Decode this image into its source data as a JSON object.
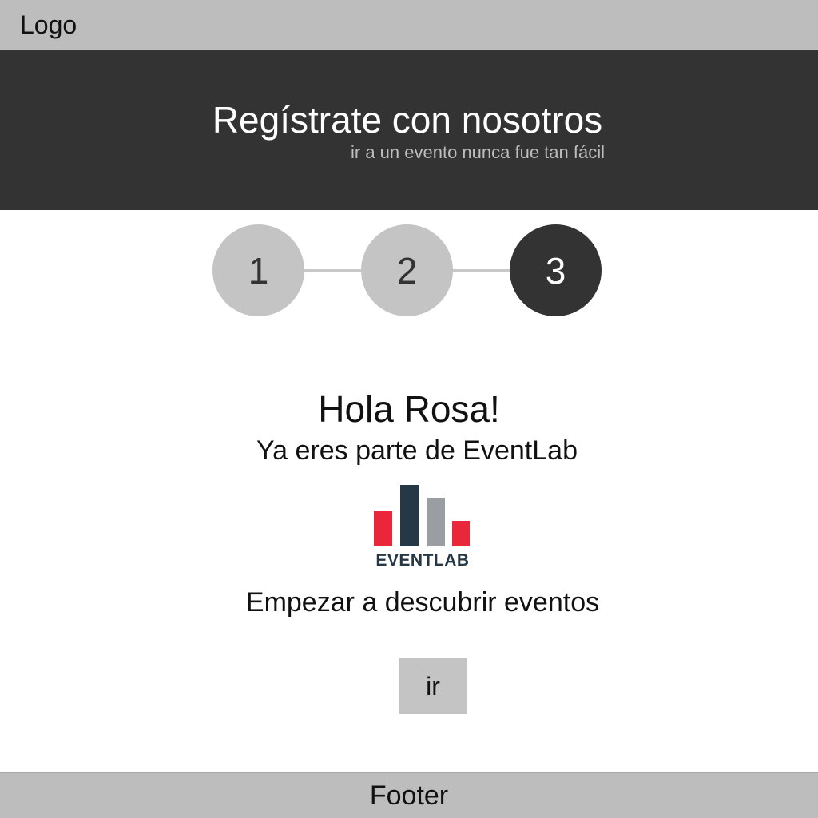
{
  "header": {
    "logo_label": "Logo"
  },
  "hero": {
    "title": "Regístrate con nosotros",
    "subtitle": "ir a un evento nunca fue tan fácil"
  },
  "stepper": {
    "steps": [
      {
        "label": "1",
        "state": "completed"
      },
      {
        "label": "2",
        "state": "completed"
      },
      {
        "label": "3",
        "state": "active"
      }
    ],
    "current_step": 3
  },
  "main": {
    "greeting": "Hola Rosa!",
    "tagline": "Ya eres parte de EventLab",
    "brand_logo": {
      "wordmark": "EVENTLAB",
      "bar_colors": [
        "#e8283a",
        "#263845",
        "#9a9ea3",
        "#e8283a"
      ]
    },
    "cta_text": "Empezar a descubrir eventos",
    "go_button_label": "ir"
  },
  "footer": {
    "label": "Footer"
  },
  "colors": {
    "bar_gray": "#bdbdbd",
    "hero_dark": "#333333",
    "step_inactive": "#c4c4c4",
    "step_active": "#333333",
    "connector": "#c8c8c8"
  }
}
